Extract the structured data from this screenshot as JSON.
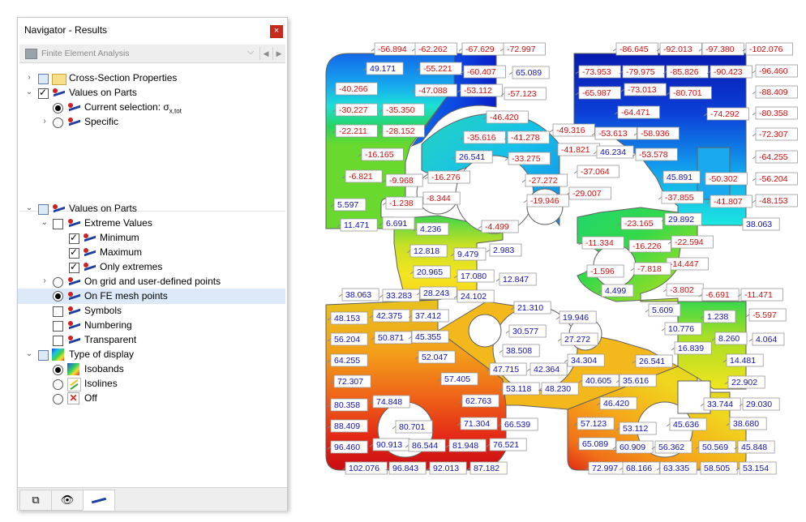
{
  "navigator": {
    "title": "Navigator - Results",
    "close_glyph": "×",
    "dropdown": {
      "value": "Finite Element Analysis",
      "icon": "fea-icon"
    },
    "tree1": [
      {
        "label": "Cross-Section Properties",
        "checked": false,
        "expanded": false
      },
      {
        "label": "Values on Parts",
        "checked": true,
        "expanded": true
      },
      {
        "label": "Current selection: σ",
        "sub": "x,tot",
        "radio": true
      },
      {
        "label": "Specific",
        "radio": false
      }
    ],
    "tree2": [
      {
        "label": "Values on Parts"
      },
      {
        "label": "Extreme Values"
      },
      {
        "label": "Minimum",
        "checked": true
      },
      {
        "label": "Maximum",
        "checked": true
      },
      {
        "label": "Only extremes",
        "checked": true
      },
      {
        "label": "On grid and user-defined points",
        "radio": false
      },
      {
        "label": "On FE mesh points",
        "radio": true
      },
      {
        "label": "Symbols",
        "checked": false
      },
      {
        "label": "Numbering",
        "checked": false
      },
      {
        "label": "Transparent",
        "checked": false
      },
      {
        "label": "Type of display"
      },
      {
        "label": "Isobands",
        "radio": true
      },
      {
        "label": "Isolines",
        "radio": false
      },
      {
        "label": "Off",
        "radio": false
      }
    ],
    "tabs": [
      "data-tab-icon",
      "eye-icon",
      "results-tab-icon"
    ]
  },
  "colors": {
    "accent": "#c42b1c",
    "negative_label": "#d01010",
    "positive_label": "#1010c0",
    "selection": "#dbe9f8"
  },
  "labels": [
    {
      "t": "-56.894"
    },
    {
      "t": "-62.262"
    },
    {
      "t": "-67.629"
    },
    {
      "t": "-72.997"
    },
    {
      "t": "-86.645"
    },
    {
      "t": "-92.013"
    },
    {
      "t": "-97.380"
    },
    {
      "t": "-102.076"
    },
    {
      "t": "49.171"
    },
    {
      "t": "-55.221"
    },
    {
      "t": "-60.407"
    },
    {
      "t": "65.089"
    },
    {
      "t": "-73.953"
    },
    {
      "t": "-79.975"
    },
    {
      "t": "-85.826"
    },
    {
      "t": "-90.423"
    },
    {
      "t": "-96.460"
    },
    {
      "t": "-40.266"
    },
    {
      "t": "-47.088"
    },
    {
      "t": "-53.112"
    },
    {
      "t": "-57.123"
    },
    {
      "t": "-65.987"
    },
    {
      "t": "-73.013"
    },
    {
      "t": "-80.701"
    },
    {
      "t": "-88.409"
    },
    {
      "t": "-30.227"
    },
    {
      "t": "-35.350"
    },
    {
      "t": "-46.420"
    },
    {
      "t": "-64.471"
    },
    {
      "t": "-74.292"
    },
    {
      "t": "-80.358"
    },
    {
      "t": "-22.211"
    },
    {
      "t": "-28.152"
    },
    {
      "t": "-35.616"
    },
    {
      "t": "-41.278"
    },
    {
      "t": "-49.316"
    },
    {
      "t": "-53.613"
    },
    {
      "t": "-58.936"
    },
    {
      "t": "-72.307"
    },
    {
      "t": "-41.821"
    },
    {
      "t": "46.234"
    },
    {
      "t": "-16.165"
    },
    {
      "t": "26.541"
    },
    {
      "t": "-33.275"
    },
    {
      "t": "-53.578"
    },
    {
      "t": "-64.255"
    },
    {
      "t": "-37.064"
    },
    {
      "t": "-6.821"
    },
    {
      "t": "-9.968"
    },
    {
      "t": "-16.276"
    },
    {
      "t": "-27.272"
    },
    {
      "t": "45.891"
    },
    {
      "t": "-50.302"
    },
    {
      "t": "-56.204"
    },
    {
      "t": "-29.007"
    },
    {
      "t": "-8.344"
    },
    {
      "t": "-19.946"
    },
    {
      "t": "-37.855"
    },
    {
      "t": "-41.807"
    },
    {
      "t": "-48.153"
    },
    {
      "t": "5.597"
    },
    {
      "t": "-1.238"
    },
    {
      "t": "-23.165"
    },
    {
      "t": "29.892"
    },
    {
      "t": "11.471"
    },
    {
      "t": "6.691"
    },
    {
      "t": "4.236"
    },
    {
      "t": "-4.499"
    },
    {
      "t": "38.063"
    },
    {
      "t": "-11.334"
    },
    {
      "t": "-16.226"
    },
    {
      "t": "-22.594"
    },
    {
      "t": "12.818"
    },
    {
      "t": "9.479"
    },
    {
      "t": "2.983"
    },
    {
      "t": "-14.447"
    },
    {
      "t": "20.965"
    },
    {
      "t": "-1.596"
    },
    {
      "t": "-7.818"
    },
    {
      "t": "17.080"
    },
    {
      "t": "12.847"
    },
    {
      "t": "38.063"
    },
    {
      "t": "33.283"
    },
    {
      "t": "28.243"
    },
    {
      "t": "24.102"
    },
    {
      "t": "4.499"
    },
    {
      "t": "-3.802"
    },
    {
      "t": "-6.691"
    },
    {
      "t": "-11.471"
    },
    {
      "t": "21.310"
    },
    {
      "t": "5.609"
    },
    {
      "t": "1.238"
    },
    {
      "t": "48.153"
    },
    {
      "t": "42.375"
    },
    {
      "t": "37.412"
    },
    {
      "t": "19.946"
    },
    {
      "t": "-5.597"
    },
    {
      "t": "30.577"
    },
    {
      "t": "10.776"
    },
    {
      "t": "56.204"
    },
    {
      "t": "50.871"
    },
    {
      "t": "45.355"
    },
    {
      "t": "27.272"
    },
    {
      "t": "38.508"
    },
    {
      "t": "8.260"
    },
    {
      "t": "4.064"
    },
    {
      "t": "16.839"
    },
    {
      "t": "64.255"
    },
    {
      "t": "52.047"
    },
    {
      "t": "34.304"
    },
    {
      "t": "26.541"
    },
    {
      "t": "14.481"
    },
    {
      "t": "47.715"
    },
    {
      "t": "42.364"
    },
    {
      "t": "72.307"
    },
    {
      "t": "57.405"
    },
    {
      "t": "40.605"
    },
    {
      "t": "35.616"
    },
    {
      "t": "22.902"
    },
    {
      "t": "53.118"
    },
    {
      "t": "48.230"
    },
    {
      "t": "62.763"
    },
    {
      "t": "46.420"
    },
    {
      "t": "80.358"
    },
    {
      "t": "74.848"
    },
    {
      "t": "33.744"
    },
    {
      "t": "29.030"
    },
    {
      "t": "71.304"
    },
    {
      "t": "66.539"
    },
    {
      "t": "57.123"
    },
    {
      "t": "53.112"
    },
    {
      "t": "45.636"
    },
    {
      "t": "38.680"
    },
    {
      "t": "88.409"
    },
    {
      "t": "80.701"
    },
    {
      "t": "96.460"
    },
    {
      "t": "90.913"
    },
    {
      "t": "86.544"
    },
    {
      "t": "81.948"
    },
    {
      "t": "76.521"
    },
    {
      "t": "65.089"
    },
    {
      "t": "60.909"
    },
    {
      "t": "56.362"
    },
    {
      "t": "50.569"
    },
    {
      "t": "45.848"
    },
    {
      "t": "102.076"
    },
    {
      "t": "96.843"
    },
    {
      "t": "92.013"
    },
    {
      "t": "87.182"
    },
    {
      "t": "72.997"
    },
    {
      "t": "68.166"
    },
    {
      "t": "63.335"
    },
    {
      "t": "58.505"
    },
    {
      "t": "53.154"
    }
  ]
}
